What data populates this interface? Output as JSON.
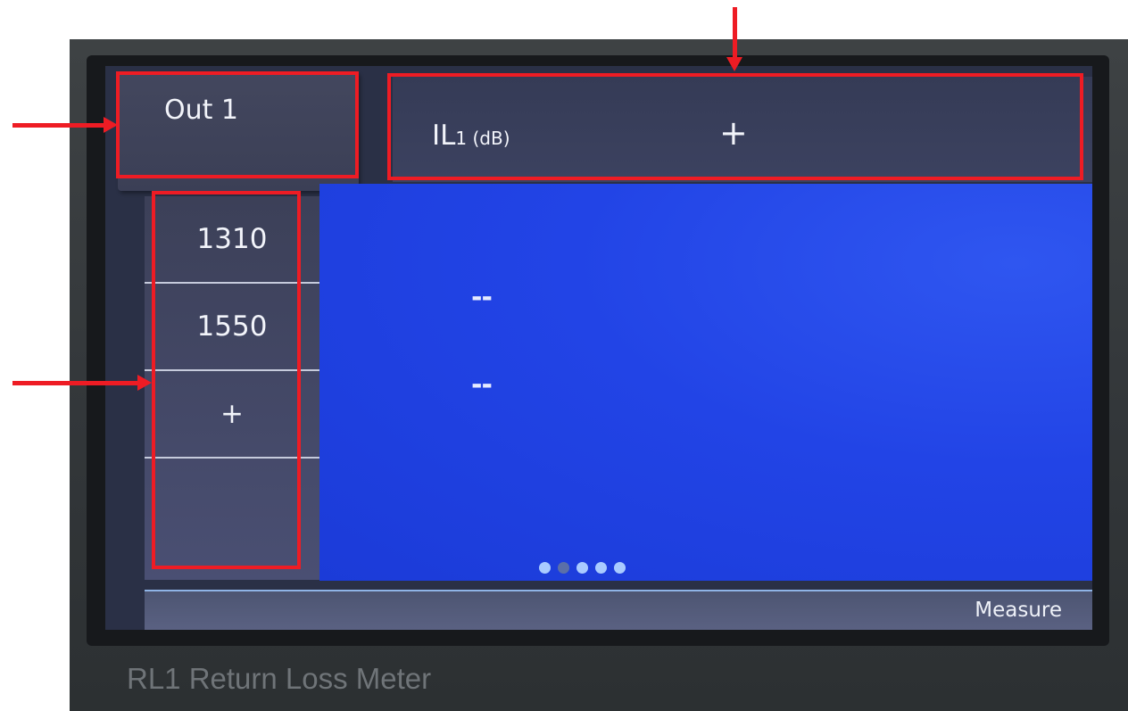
{
  "device": {
    "label": "RL1 Return Loss Meter"
  },
  "output_tab": {
    "label": "Out 1"
  },
  "header": {
    "metric_main": "IL",
    "metric_sub": "1 (dB)",
    "add_label": "+"
  },
  "wavelengths": [
    {
      "label": "1310",
      "value": "--"
    },
    {
      "label": "1550",
      "value": "--"
    }
  ],
  "add_wavelength_label": "+",
  "pager": {
    "page_count": 5,
    "current_page": 2
  },
  "footer": {
    "measure_label": "Measure"
  },
  "colors": {
    "content_blue": "#2244e6",
    "panel_navy": "#3c4058",
    "annotation_red": "#ee1c24"
  }
}
